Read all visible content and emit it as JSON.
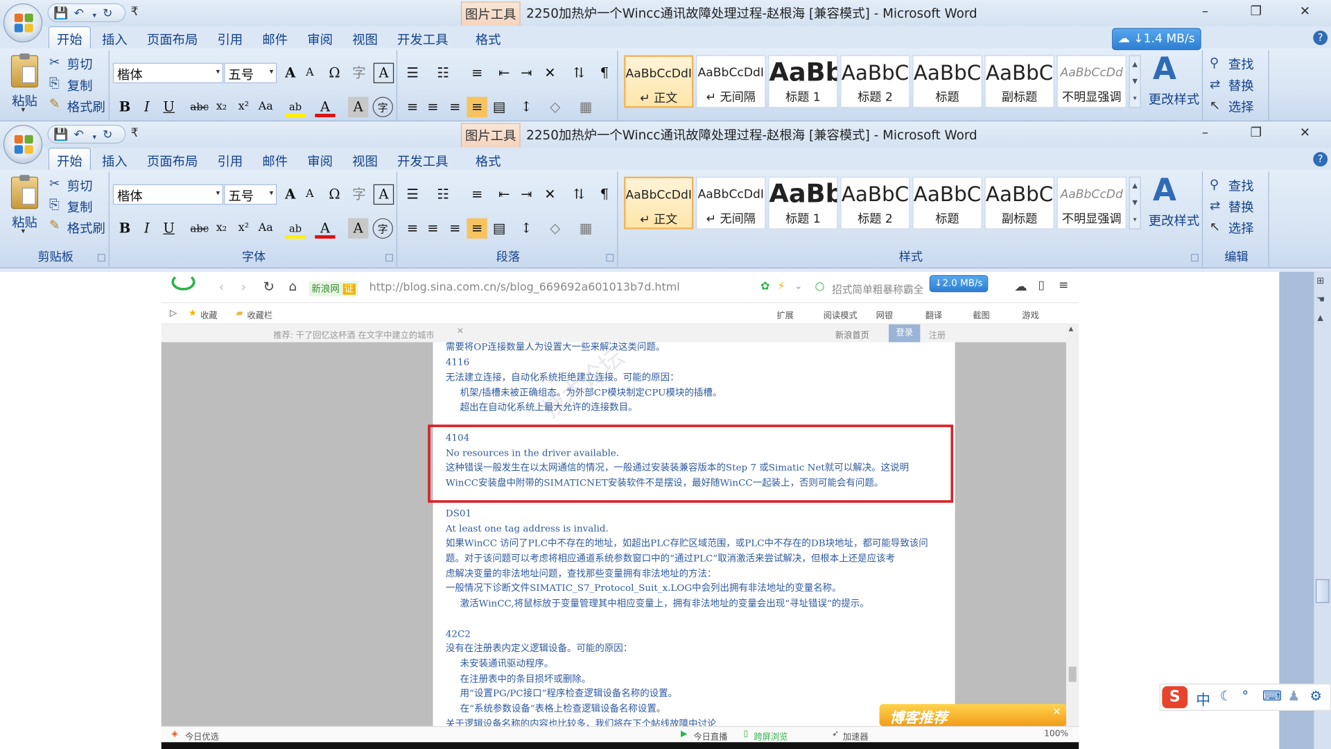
{
  "window": {
    "title": "2250加热炉一个Wincc通讯故障处理过程-赵根海 [兼容模式] - Microsoft Word",
    "contextual_tab": "图片工具",
    "minimize": "–",
    "restore": "❐",
    "close": "✕"
  },
  "qat": {
    "save": "💾",
    "undo": "↶",
    "redo": "↻",
    "customize": "₹"
  },
  "tabs": [
    "开始",
    "插入",
    "页面布局",
    "引用",
    "邮件",
    "审阅",
    "视图",
    "开发工具",
    "格式"
  ],
  "clipboard": {
    "paste": "粘贴",
    "cut": "剪切",
    "copy": "复制",
    "format_painter": "格式刷",
    "group": "剪贴板"
  },
  "font": {
    "name": "楷体",
    "size": "五号",
    "group": "字体",
    "buttons": [
      "A",
      "A",
      "Ω",
      "字",
      "A",
      "B",
      "I",
      "U",
      "abc",
      "x₂",
      "x²",
      "Aa",
      "ab",
      "A",
      "A",
      "字"
    ]
  },
  "paragraph": {
    "group": "段落"
  },
  "styles": {
    "group": "样式",
    "items": [
      {
        "preview": "AaBbCcDdI",
        "name": "↵ 正文"
      },
      {
        "preview": "AaBbCcDdI",
        "name": "↵ 无间隔"
      },
      {
        "preview": "AaBb",
        "name": "标题 1"
      },
      {
        "preview": "AaBbC",
        "name": "标题 2"
      },
      {
        "preview": "AaBbC",
        "name": "标题"
      },
      {
        "preview": "AaBbC",
        "name": "副标题"
      },
      {
        "preview": "AaBbCcDd",
        "name": "不明显强调"
      }
    ],
    "change": "更改样式"
  },
  "editing": {
    "find": "查找",
    "replace": "替换",
    "select": "选择",
    "group": "编辑"
  },
  "network_badge": {
    "top": "↓1.4 MB/s",
    "browser": "↓2.0 MB/s"
  },
  "browser": {
    "url": "http://blog.sina.com.cn/s/blog_669692a601013b7d.html",
    "site_badge": "新浪网",
    "cert": "证",
    "search": "招式简单粗暴称霸全",
    "favorites": [
      "收藏",
      "收藏栏"
    ],
    "toolbar": [
      "扩展",
      "阅读模式",
      "网银",
      "翻译",
      "截图",
      "游戏"
    ],
    "recommend": "推荐: 干了回忆这杯酒   在文字中建立的城市",
    "links": [
      "新浪首页",
      "登录",
      "注册"
    ],
    "status": [
      "今日优选",
      "今日直播",
      "跨屏浏览",
      "加速器",
      "100%"
    ],
    "popup": "博客推荐",
    "watermark": "技术论坛"
  },
  "article": {
    "lines": [
      "需要将OP连接数量人为设置大一些来解决这类问题。",
      "4116",
      "无法建立连接，自动化系统拒绝建立连接。可能的原因：",
      "机架/插槽未被正确组态。为外部CP模块制定CPU模块的插槽。",
      "超出在自动化系统上最大允许的连接数目。",
      "4104",
      "No resources in the driver available.",
      "这种错误一般发生在以太网通信的情况，一般通过安装装兼容版本的Step 7 或Simatic Net就可以解决。这说明",
      "WinCC安装盘中附带的SIMATICNET安装软件不是摆设，最好随WinCC一起装上，否则可能会有问题。",
      "DS01",
      "At least one tag address is invalid.",
      "如果WinCC 访问了PLC中不存在的地址，如超出PLC存贮区域范围，或PLC中不存在的DB块地址，都可能导致该问",
      "题。对于该问题可以考虑将相应通道系统参数窗口中的“通过PLC”取消激活来尝试解决，但根本上还是应该考",
      "虑解决变量的非法地址问题，查找那些变量拥有非法地址的方法：",
      "一般情况下诊断文件SIMATIC_S7_Protocol_Suit_x.LOG中会列出拥有非法地址的变量名称。",
      "激活WinCC,将鼠标放于变量管理其中相应变量上，拥有非法地址的变量会出现“寻址错误”的提示。",
      "42C2",
      "没有在注册表内定义逻辑设备。可能的原因：",
      "未安装通讯驱动程序。",
      "在注册表中的条目损坏或删除。",
      "用“设置PG/PC接口”程序检查逻辑设备名称的设置。",
      "在“系统参数设备”表格上检查逻辑设备名称设置。",
      "关于逻辑设备名称的内容也比较多，我们将在下个帖线故障中讨论"
    ]
  },
  "ime": {
    "lang": "中"
  }
}
